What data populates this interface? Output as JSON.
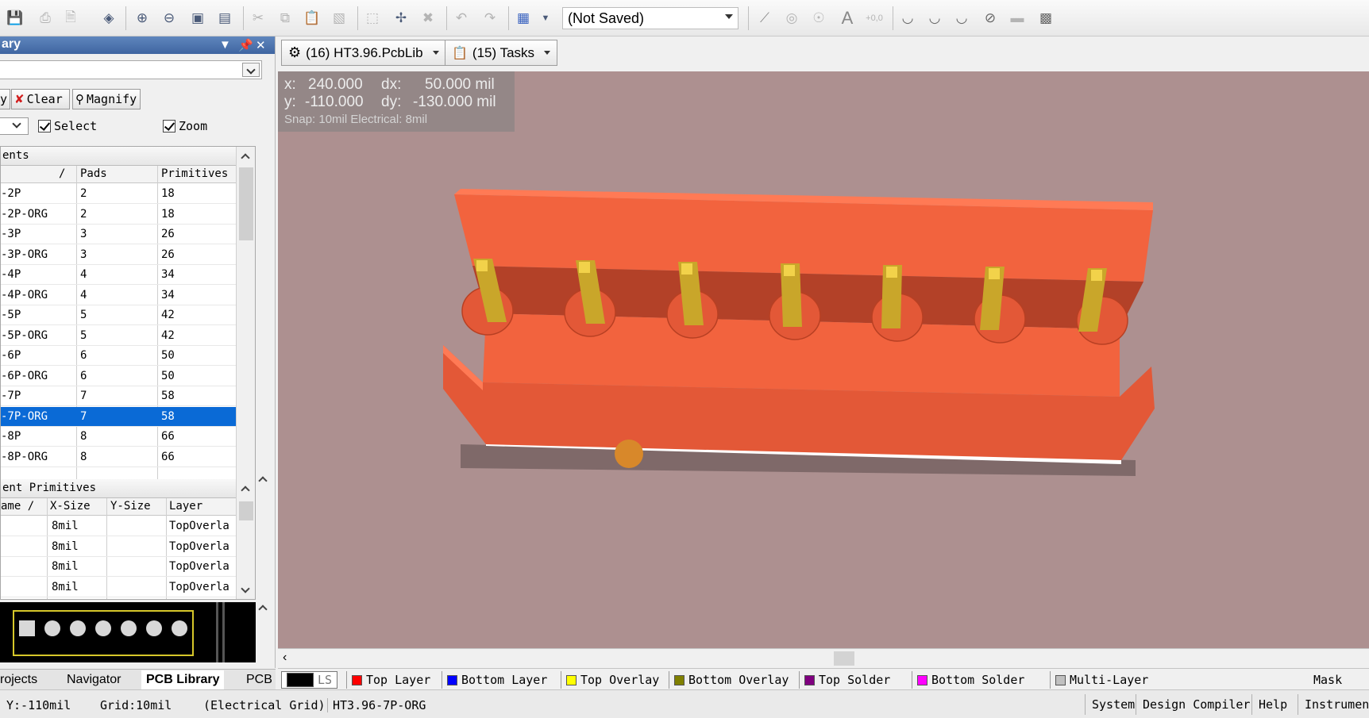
{
  "toolbar": {
    "items": [
      "save-icon",
      "print-icon",
      "print-preview-icon",
      "3d-view-icon",
      "zoom-in-icon",
      "zoom-out-icon",
      "zoom-fit-icon",
      "zoom-area-icon",
      "cut-icon",
      "copy-icon",
      "paste-icon",
      "rubber-stamp-icon",
      "select-area-icon",
      "move-icon",
      "cross-select-icon",
      "undo-icon",
      "redo-icon",
      "grid-icon",
      "line-icon",
      "pad-icon",
      "via-icon",
      "text-icon",
      "coordinate-icon",
      "arc-center-icon",
      "arc-edge-icon",
      "arc-any-icon",
      "circle-icon",
      "fill-icon",
      "array-paste-icon"
    ],
    "variant_combo": "(Not Saved)"
  },
  "library_panel": {
    "title": "ary",
    "buttons": {
      "apply": "y",
      "clear": "Clear",
      "magnify": "Magnify"
    },
    "select_label": "Select",
    "zoom_label": "Zoom",
    "components": {
      "header": "ents",
      "columns": [
        "/",
        "Pads",
        "Primitives"
      ],
      "rows": [
        {
          "name": "-2P",
          "pads": "2",
          "primitives": "18"
        },
        {
          "name": "-2P-ORG",
          "pads": "2",
          "primitives": "18"
        },
        {
          "name": "-3P",
          "pads": "3",
          "primitives": "26"
        },
        {
          "name": "-3P-ORG",
          "pads": "3",
          "primitives": "26"
        },
        {
          "name": "-4P",
          "pads": "4",
          "primitives": "34"
        },
        {
          "name": "-4P-ORG",
          "pads": "4",
          "primitives": "34"
        },
        {
          "name": "-5P",
          "pads": "5",
          "primitives": "42"
        },
        {
          "name": "-5P-ORG",
          "pads": "5",
          "primitives": "42"
        },
        {
          "name": "-6P",
          "pads": "6",
          "primitives": "50"
        },
        {
          "name": "-6P-ORG",
          "pads": "6",
          "primitives": "50"
        },
        {
          "name": "-7P",
          "pads": "7",
          "primitives": "58"
        },
        {
          "name": "-7P-ORG",
          "pads": "7",
          "primitives": "58"
        },
        {
          "name": "-8P",
          "pads": "8",
          "primitives": "66"
        },
        {
          "name": "-8P-ORG",
          "pads": "8",
          "primitives": "66"
        }
      ]
    },
    "primitives": {
      "header": "ent Primitives",
      "columns": [
        "ame /",
        "X-Size",
        "Y-Size",
        "Layer"
      ],
      "rows": [
        {
          "xsize": "8mil",
          "layer": "TopOverla"
        },
        {
          "xsize": "8mil",
          "layer": "TopOverla"
        },
        {
          "xsize": "8mil",
          "layer": "TopOverla"
        },
        {
          "xsize": "8mil",
          "layer": "TopOverla"
        }
      ]
    },
    "tabs": [
      "rojects",
      "Navigator",
      "PCB Library",
      "PCB"
    ]
  },
  "doc_tabs": [
    {
      "label": "(16) HT3.96.PcbLib",
      "icon": "pcblib-icon"
    },
    {
      "label": "(15) Tasks",
      "icon": "tasks-icon"
    }
  ],
  "hud": {
    "x_label": "x:",
    "x": "240.000",
    "dx_label": "dx:",
    "dx": "50.000 mil",
    "y_label": "y:",
    "y": "-110.000",
    "dy_label": "dy:",
    "dy": "-130.000 mil",
    "snap": "Snap: 10mil Electrical: 8mil"
  },
  "layers": [
    {
      "label": "LS",
      "color": "#000000"
    },
    {
      "label": "Top Layer",
      "color": "#ff0000"
    },
    {
      "label": "Bottom Layer",
      "color": "#0000ff"
    },
    {
      "label": "Top Overlay",
      "color": "#ffff00"
    },
    {
      "label": "Bottom Overlay",
      "color": "#808000"
    },
    {
      "label": "Top Solder",
      "color": "#800080"
    },
    {
      "label": "Bottom Solder",
      "color": "#ff00ff"
    },
    {
      "label": "Multi-Layer",
      "color": "#c0c0c0"
    }
  ],
  "mask_level": "Mask Lev",
  "status": {
    "y": "Y:-110mil",
    "grid": "Grid:10mil",
    "electrical": "(Electrical Grid)",
    "component": "HT3.96-7P-ORG",
    "buttons": [
      "System",
      "Design Compiler",
      "Help",
      "Instrument"
    ]
  },
  "colors": {
    "body": "#f2633e",
    "pins": "#c9a62a",
    "viewport": "#ad9090",
    "selection": "#0a6ad6"
  }
}
